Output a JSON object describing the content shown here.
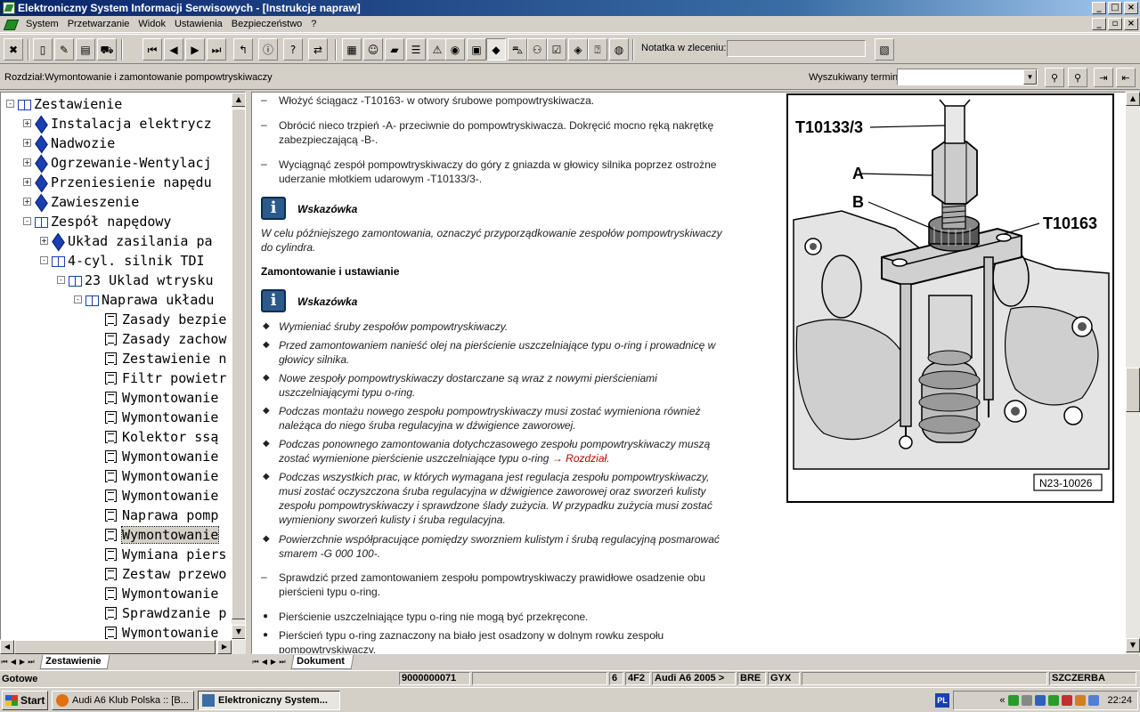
{
  "window": {
    "title": "Elektroniczny System Informacji Serwisowych - [Instrukcje napraw]"
  },
  "menu": [
    "System",
    "Przetwarzanie",
    "Widok",
    "Ustawienia",
    "Bezpieczeństwo",
    "?"
  ],
  "toolbar": {
    "note_label": "Notatka w zleceniu:",
    "note_value": ""
  },
  "address": {
    "chapter": "Rozdział:Wymontowanie i zamontowanie pompowtryskiwaczy",
    "search_label": "Wyszukiwany termin",
    "search_value": ""
  },
  "tree": {
    "tab": "Zestawienie",
    "items": [
      {
        "label": "Zestawienie",
        "level": 0,
        "exp": "-",
        "icon": "open"
      },
      {
        "label": "Instalacja elektrycz",
        "level": 1,
        "exp": "+",
        "icon": "closed"
      },
      {
        "label": "Nadwozie",
        "level": 1,
        "exp": "+",
        "icon": "closed"
      },
      {
        "label": "Ogrzewanie-Wentylacj",
        "level": 1,
        "exp": "+",
        "icon": "closed"
      },
      {
        "label": "Przeniesienie napędu",
        "level": 1,
        "exp": "+",
        "icon": "closed"
      },
      {
        "label": "Zawieszenie",
        "level": 1,
        "exp": "+",
        "icon": "closed"
      },
      {
        "label": "Zespół napędowy",
        "level": 1,
        "exp": "-",
        "icon": "open"
      },
      {
        "label": "Układ zasilania pa",
        "level": 2,
        "exp": "+",
        "icon": "closed"
      },
      {
        "label": "4-cyl. silnik TDI",
        "level": 2,
        "exp": "-",
        "icon": "open"
      },
      {
        "label": "23 Uklad wtrysku",
        "level": 3,
        "exp": "-",
        "icon": "open"
      },
      {
        "label": "Naprawa układu",
        "level": 4,
        "exp": "-",
        "icon": "open"
      },
      {
        "label": "Zasady bezpie",
        "level": 5,
        "icon": "page"
      },
      {
        "label": "Zasady zachow",
        "level": 5,
        "icon": "page"
      },
      {
        "label": "Zestawienie n",
        "level": 5,
        "icon": "page"
      },
      {
        "label": "Filtr powietr",
        "level": 5,
        "icon": "page"
      },
      {
        "label": "Wymontowanie",
        "level": 5,
        "icon": "page"
      },
      {
        "label": "Wymontowanie",
        "level": 5,
        "icon": "page"
      },
      {
        "label": "Kolektor ssą",
        "level": 5,
        "icon": "page"
      },
      {
        "label": "Wymontowanie",
        "level": 5,
        "icon": "page"
      },
      {
        "label": "Wymontowanie",
        "level": 5,
        "icon": "page"
      },
      {
        "label": "Wymontowanie",
        "level": 5,
        "icon": "page"
      },
      {
        "label": "Naprawa pomp",
        "level": 5,
        "icon": "page"
      },
      {
        "label": "Wymontowanie",
        "level": 5,
        "icon": "page",
        "selected": true
      },
      {
        "label": "Wymiana piers",
        "level": 5,
        "icon": "page"
      },
      {
        "label": "Zestaw przewo",
        "level": 5,
        "icon": "page"
      },
      {
        "label": "Wymontowanie",
        "level": 5,
        "icon": "page"
      },
      {
        "label": "Sprawdzanie p",
        "level": 5,
        "icon": "page"
      },
      {
        "label": "Wymontowanie",
        "level": 5,
        "icon": "page"
      }
    ]
  },
  "doc": {
    "tab": "Dokument",
    "step1": "Włożyć ściągacz -T10163- w otwory śrubowe pompowtryskiwacza.",
    "step2a": "Obrócić nieco trzpień -A- przeciwnie do pompowtryskiwacza. Dokręcić mocno ręką nakrętkę",
    "step2b": "zabezpieczającą -B-.",
    "step3a": "Wyciągnąć zespół pompowtryskiwaczy do góry z gniazda w głowicy silnika poprzez ostrożne",
    "step3b": "uderzanie młotkiem udarowym -T10133/3-.",
    "note1_title": "Wskazówka",
    "note1a": "W celu późniejszego zamontowania, oznaczyć przyporządkowanie zespołów pompowtryskiwaczy",
    "note1b": "do cylindra.",
    "section": "Zamontowanie i ustawianie",
    "note2_title": "Wskazówka",
    "b1": "Wymieniać śruby zespołów pompowtryskiwaczy.",
    "b2a": "Przed zamontowaniem nanieść olej na pierścienie uszczelniające typu o-ring i prowadnicę w",
    "b2b": "głowicy silnika.",
    "b3a": "Nowe zespoły pompowtryskiwaczy dostarczane są wraz z nowymi pierścieniami",
    "b3b": "uszczelniającymi typu o-ring.",
    "b4a": "Podczas montażu nowego zespołu pompowtryskiwaczy musi zostać wymieniona również",
    "b4b": "należąca do niego śruba regulacyjna w dźwigience zaworowej.",
    "b5a": "Podczas ponownego zamontowania dotychczasowego zespołu pompowtryskiwaczy muszą",
    "b5b": "zostać wymienione pierścienie uszczelniające typu o-ring",
    "b5link": "→ Rozdział.",
    "b6a": "Podczas wszystkich prac, w których wymagana jest regulacja zespołu pompowtryskiwaczy,",
    "b6b": "musi zostać oczyszczona śruba regulacyjna w dźwigience zaworowej oraz sworzeń kulisty",
    "b6c": "zespołu pompowtryskiwaczy i sprawdzone ślady zużycia. W przypadku zużycia musi zostać",
    "b6d": "wymieniony sworzeń kulisty i śruba regulacyjna.",
    "b7a": "Powierzchnie współpracujące pomiędzy sworzniem kulistym i śrubą regulacyjną posmarować",
    "b7b": "smarem -G 000 100-.",
    "step4a": "Sprawdzić przed zamontowaniem zespołu pompowtryskiwaczy prawidłowe osadzenie obu",
    "step4b": "pierścieni typu o-ring.",
    "p1": "Pierścienie uszczelniające typu o-ring nie mogą być przekręcone.",
    "p2a": "Pierścień typu o-ring zaznaczony na biało jest osadzony w dolnym rowku zespołu",
    "p2b": "pompowtryskiwaczy.",
    "figure": {
      "label_tool1": "T10133/3",
      "label_a": "A",
      "label_b": "B",
      "label_tool2": "T10163",
      "code": "N23-10026"
    }
  },
  "status": {
    "ready": "Gotowe",
    "order": "9000000071",
    "c1": "6",
    "c2": "4F2",
    "model": "Audi A6 2005 >",
    "c3": "BRE",
    "c4": "GYX",
    "user": "SZCZERBA"
  },
  "taskbar": {
    "start": "Start",
    "task1": "Audi A6 Klub Polska :: [B...",
    "task2": "Elektroniczny System...",
    "lang": "PL",
    "time": "22:24"
  }
}
